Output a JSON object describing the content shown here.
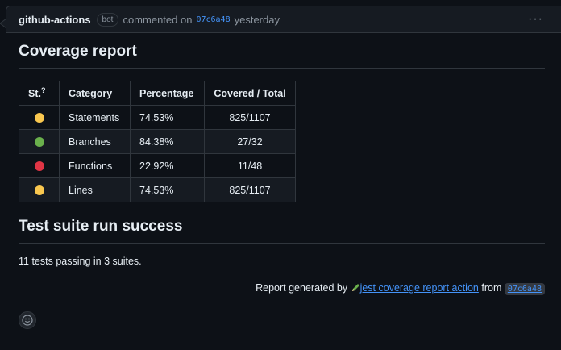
{
  "comment": {
    "author": "github-actions",
    "badge": "bot",
    "action_text": "commented on",
    "commit": "07c6a48",
    "time": "yesterday"
  },
  "coverage": {
    "title": "Coverage report",
    "headers": [
      "St.",
      "Category",
      "Percentage",
      "Covered / Total"
    ],
    "status_tooltip_mark": "?",
    "rows": [
      {
        "status_color": "#f9c74f",
        "category": "Statements",
        "percentage": "74.53%",
        "covered": "825/1107"
      },
      {
        "status_color": "#6ab04c",
        "category": "Branches",
        "percentage": "84.38%",
        "covered": "27/32"
      },
      {
        "status_color": "#e03545",
        "category": "Functions",
        "percentage": "22.92%",
        "covered": "11/48"
      },
      {
        "status_color": "#f9c74f",
        "category": "Lines",
        "percentage": "74.53%",
        "covered": "825/1107"
      }
    ]
  },
  "suite": {
    "title": "Test suite run success",
    "summary": "11 tests passing in 3 suites."
  },
  "report": {
    "prefix": "Report generated by",
    "link": "jest coverage report action",
    "from": "from",
    "commit": "07c6a48"
  }
}
